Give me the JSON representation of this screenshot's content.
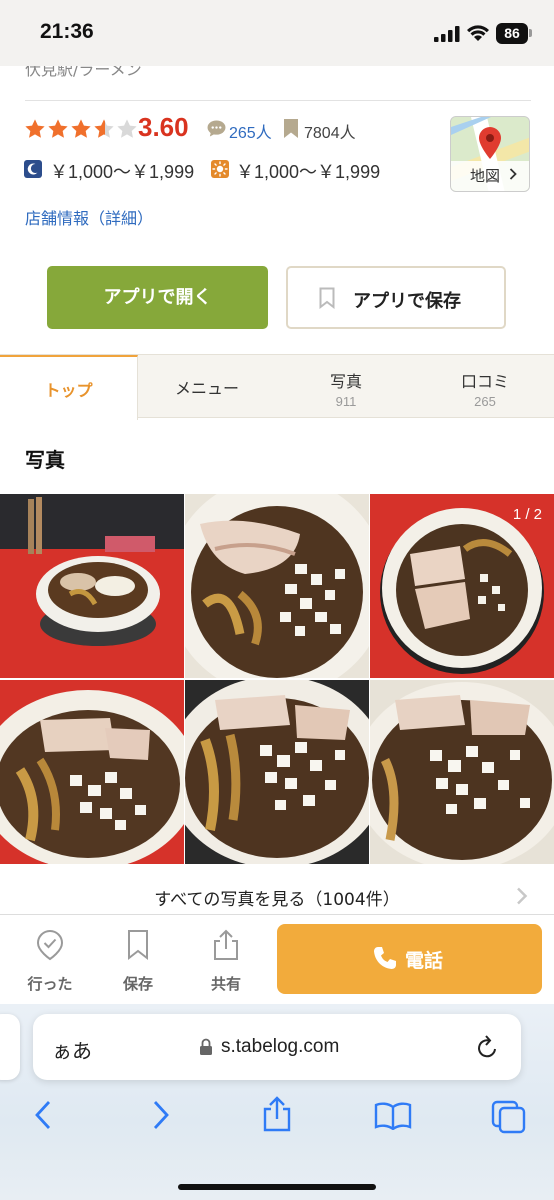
{
  "status_bar": {
    "time": "21:36",
    "battery": "86"
  },
  "restaurant": {
    "station_genre": "伏見駅/ラーメン",
    "rating": "3.60",
    "review_count": "265人",
    "bookmark_count": "7804人",
    "budget_dinner": "￥1,000～￥1,999",
    "budget_lunch": "￥1,000～￥1,999",
    "detail_link": "店舗情報（詳細）",
    "map_label": "地図"
  },
  "buttons": {
    "open_app": "アプリで開く",
    "save_app": "アプリで保存"
  },
  "tabs": [
    {
      "label": "トップ",
      "count": ""
    },
    {
      "label": "メニュー",
      "count": ""
    },
    {
      "label": "写真",
      "count": "911"
    },
    {
      "label": "口コミ",
      "count": "265"
    }
  ],
  "photos": {
    "section_title": "写真",
    "page_indicator": "1 / 2",
    "see_all": "すべての写真を見る（1004件）"
  },
  "action_bar": {
    "went": "行った",
    "save": "保存",
    "share": "共有",
    "call": "電話"
  },
  "safari": {
    "aa": "ぁあ",
    "url": "s.tabelog.com"
  },
  "colors": {
    "accent_orange": "#f2ab3c",
    "rating_red": "#d9331f",
    "app_green": "#86a83a",
    "link_blue": "#2f6bbf"
  }
}
